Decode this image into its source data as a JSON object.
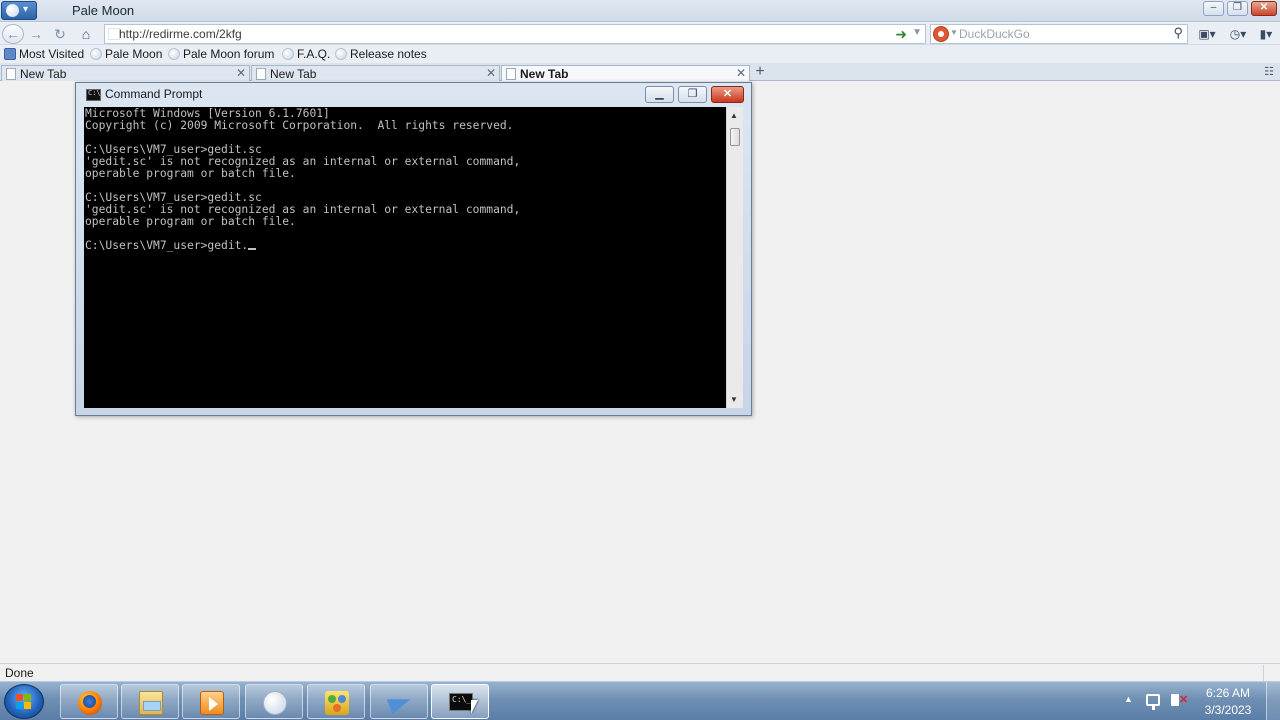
{
  "browser": {
    "title": "Pale Moon",
    "url": "http://redirme.com/2kfg",
    "search_placeholder": "DuckDuckGo",
    "bookmarks": [
      "Most Visited",
      "Pale Moon",
      "Pale Moon forum",
      "F.A.Q.",
      "Release notes"
    ],
    "tabs": [
      {
        "label": "New Tab",
        "active": false
      },
      {
        "label": "New Tab",
        "active": false
      },
      {
        "label": "New Tab",
        "active": true
      }
    ],
    "status": "Done"
  },
  "cmd": {
    "title": "Command Prompt",
    "lines": [
      "Microsoft Windows [Version 6.1.7601]",
      "Copyright (c) 2009 Microsoft Corporation.  All rights reserved.",
      "",
      "C:\\Users\\VM7_user>gedit.sc",
      "'gedit.sc' is not recognized as an internal or external command,",
      "operable program or batch file.",
      "",
      "C:\\Users\\VM7_user>gedit.sc",
      "'gedit.sc' is not recognized as an internal or external command,",
      "operable program or batch file.",
      "",
      "C:\\Users\\VM7_user>gedit."
    ]
  },
  "taskbar": {
    "items": [
      {
        "name": "firefox-icon"
      },
      {
        "name": "explorer-icon"
      },
      {
        "name": "media-player-icon"
      },
      {
        "name": "pale-moon-icon"
      },
      {
        "name": "people-icon"
      },
      {
        "name": "plane-icon"
      },
      {
        "name": "command-prompt-icon",
        "active": true
      }
    ],
    "time": "6:26 AM",
    "date": "3/3/2023"
  }
}
